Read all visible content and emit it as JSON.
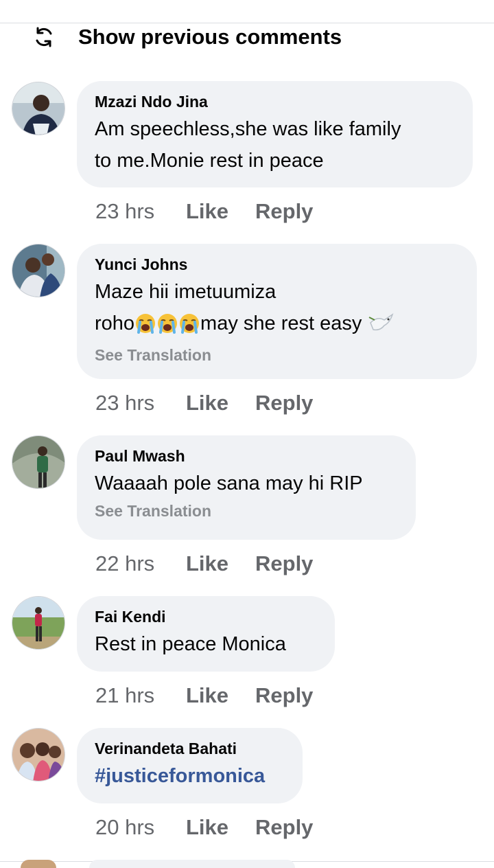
{
  "header": {
    "show_previous_label": "Show previous comments",
    "icon": "refresh-icon"
  },
  "comments": [
    {
      "author": "Mzazi Ndo Jina",
      "lines": [
        "Am speechless,she was like family",
        "to me.Monie rest in peace"
      ],
      "time": "23 hrs",
      "like_label": "Like",
      "reply_label": "Reply"
    },
    {
      "author": "Yunci Johns",
      "line1": "Maze hii imetuumiza",
      "line2_start": "roho",
      "line2_end": "may she rest easy",
      "emojis": [
        "crying-face-emoji",
        "crying-face-emoji",
        "crying-face-emoji",
        "dove-emoji"
      ],
      "see_translation": "See Translation",
      "time": "23 hrs",
      "like_label": "Like",
      "reply_label": "Reply"
    },
    {
      "author": "Paul Mwash",
      "lines": [
        "Waaaah pole sana may hi RIP"
      ],
      "see_translation": "See Translation",
      "time": "22 hrs",
      "like_label": "Like",
      "reply_label": "Reply"
    },
    {
      "author": "Fai Kendi",
      "lines": [
        "Rest in peace Monica"
      ],
      "time": "21 hrs",
      "like_label": "Like",
      "reply_label": "Reply"
    },
    {
      "author": "Verinandeta Bahati",
      "hashtag": "#justiceformonica",
      "time": "20 hrs",
      "like_label": "Like",
      "reply_label": "Reply"
    }
  ],
  "colors": {
    "bubble": "#f0f2f5",
    "meta_text": "#65676b",
    "hashtag": "#385898",
    "see_translation": "#8a8d91"
  }
}
